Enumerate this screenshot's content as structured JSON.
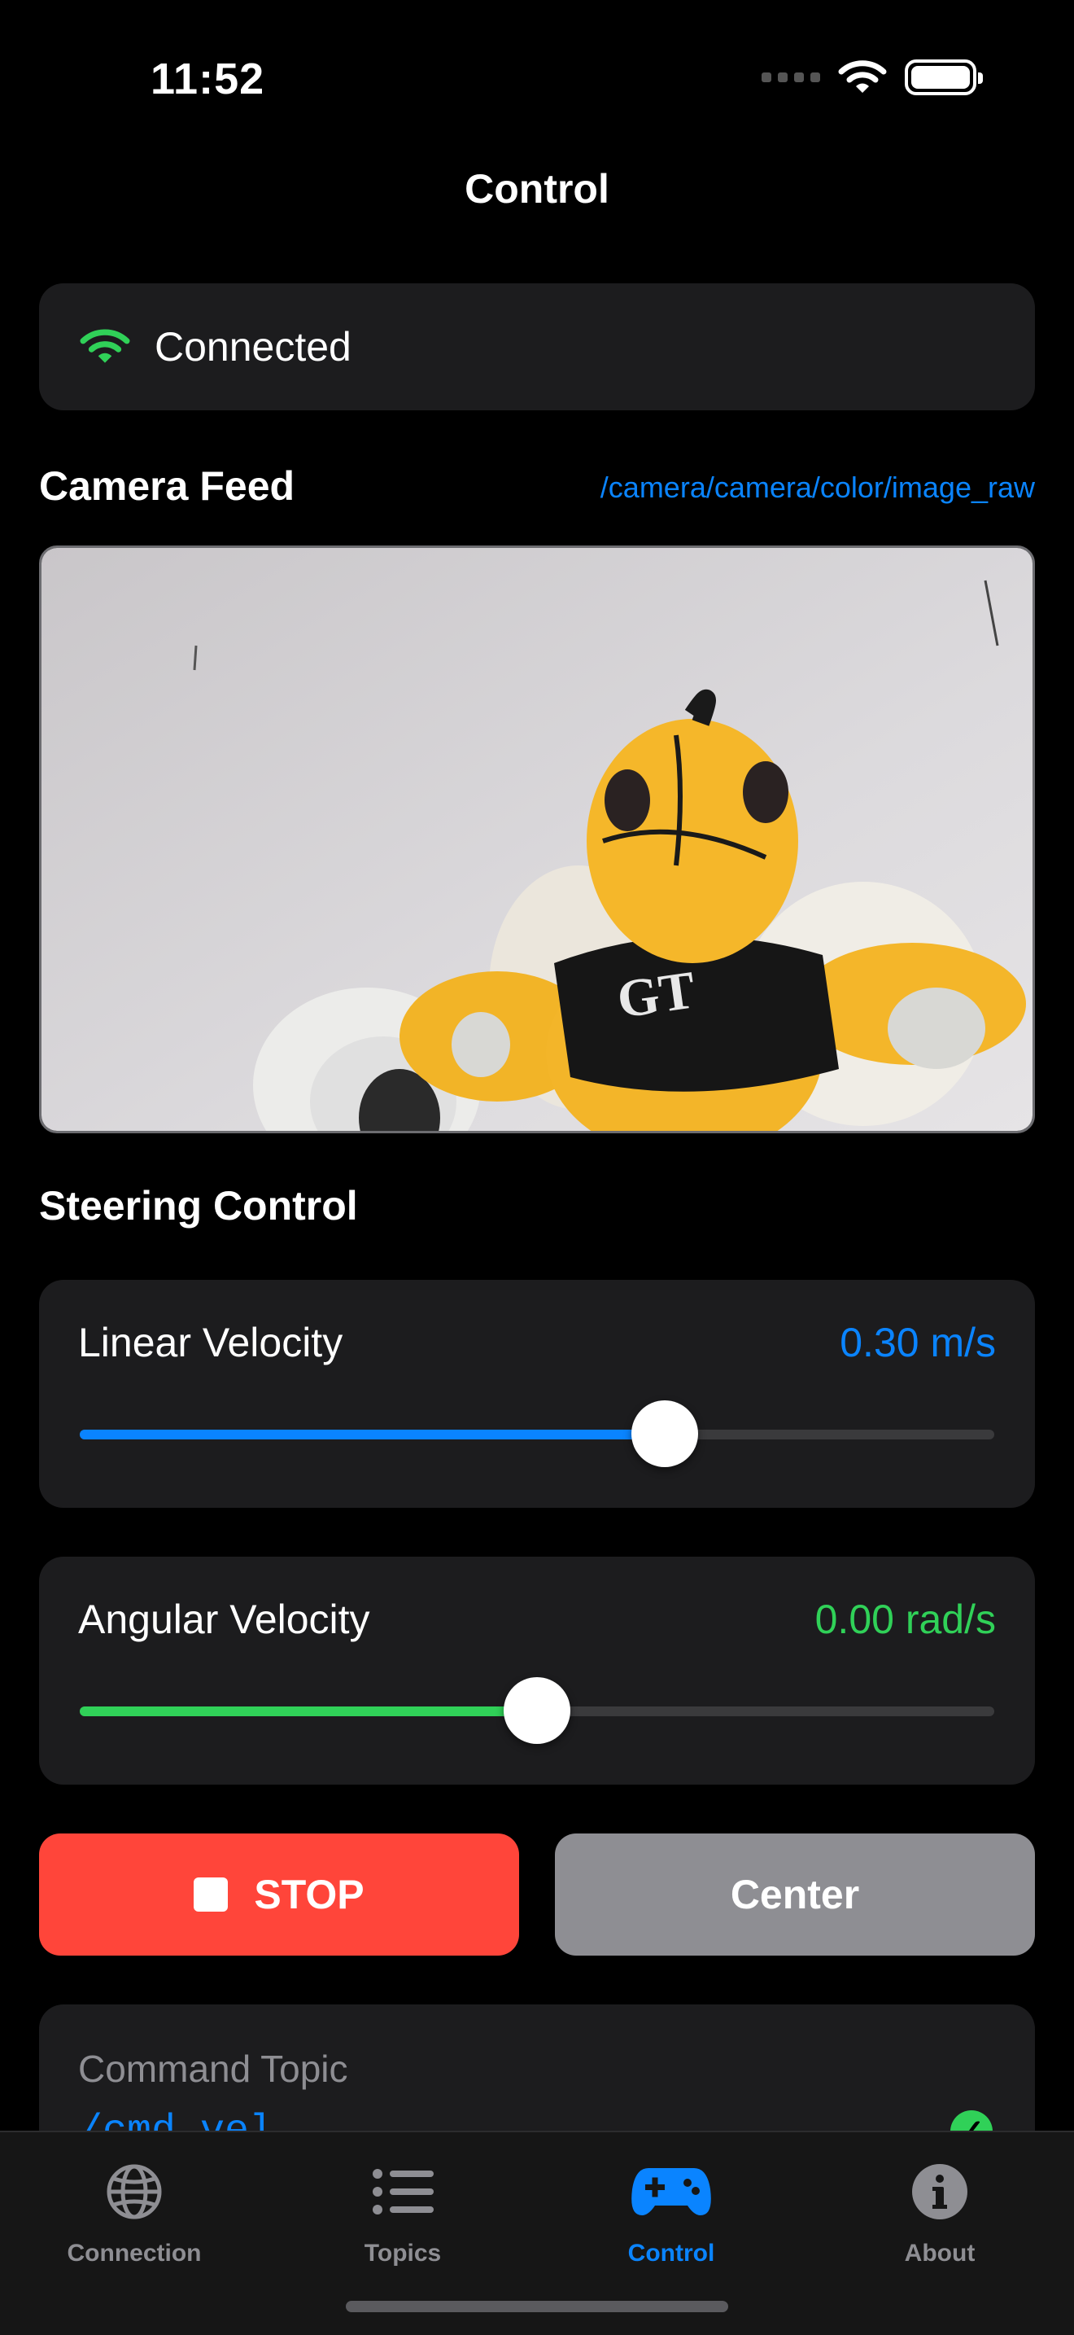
{
  "status_bar": {
    "time": "11:52"
  },
  "nav": {
    "title": "Control"
  },
  "connection": {
    "status": "Connected",
    "status_color": "#30d158"
  },
  "camera": {
    "section_title": "Camera Feed",
    "topic": "/camera/camera/color/image_raw",
    "shirt_logo": "GT"
  },
  "steering": {
    "section_title": "Steering Control",
    "linear": {
      "label": "Linear Velocity",
      "value_text": "0.30 m/s",
      "position": 0.64,
      "color": "#0a84ff"
    },
    "angular": {
      "label": "Angular Velocity",
      "value_text": "0.00 rad/s",
      "position": 0.5,
      "color": "#30d158"
    }
  },
  "buttons": {
    "stop_label": "STOP",
    "center_label": "Center"
  },
  "command": {
    "label": "Command Topic",
    "value": "/cmd_vel"
  },
  "tabs": [
    {
      "label": "Connection",
      "icon": "globe-icon"
    },
    {
      "label": "Topics",
      "icon": "list-icon"
    },
    {
      "label": "Control",
      "icon": "gamepad-icon",
      "active": true
    },
    {
      "label": "About",
      "icon": "info-icon"
    }
  ]
}
